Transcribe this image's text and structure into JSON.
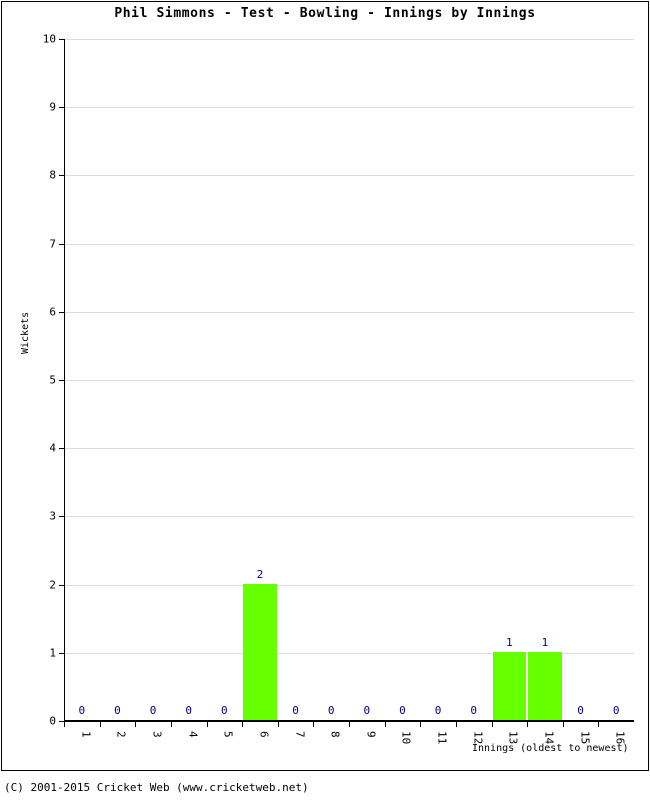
{
  "footer": {
    "copyright": "(C) 2001-2015 Cricket Web (www.cricketweb.net)"
  },
  "chart_data": {
    "type": "bar",
    "title": "Phil Simmons - Test - Bowling - Innings by Innings",
    "xlabel": "Innings (oldest to newest)",
    "ylabel": "Wickets",
    "categories": [
      "1",
      "2",
      "3",
      "4",
      "5",
      "6",
      "7",
      "8",
      "9",
      "10",
      "11",
      "12",
      "13",
      "14",
      "15",
      "16"
    ],
    "values": [
      0,
      0,
      0,
      0,
      0,
      2,
      0,
      0,
      0,
      0,
      0,
      0,
      1,
      1,
      0,
      0
    ],
    "data_labels": [
      "0",
      "0",
      "0",
      "0",
      "0",
      "2",
      "0",
      "0",
      "0",
      "0",
      "0",
      "0",
      "1",
      "1",
      "0",
      "0"
    ],
    "ylim": [
      0,
      10
    ],
    "ytick_labels": [
      "0",
      "1",
      "2",
      "3",
      "4",
      "5",
      "6",
      "7",
      "8",
      "9",
      "10"
    ],
    "ytick_values": [
      0,
      1,
      2,
      3,
      4,
      5,
      6,
      7,
      8,
      9,
      10
    ],
    "grid": true,
    "legend": false,
    "bar_color": "#66ff00",
    "label_color": "#000080",
    "grid_color": "#dcdcdc",
    "axis_color": "#000000"
  }
}
